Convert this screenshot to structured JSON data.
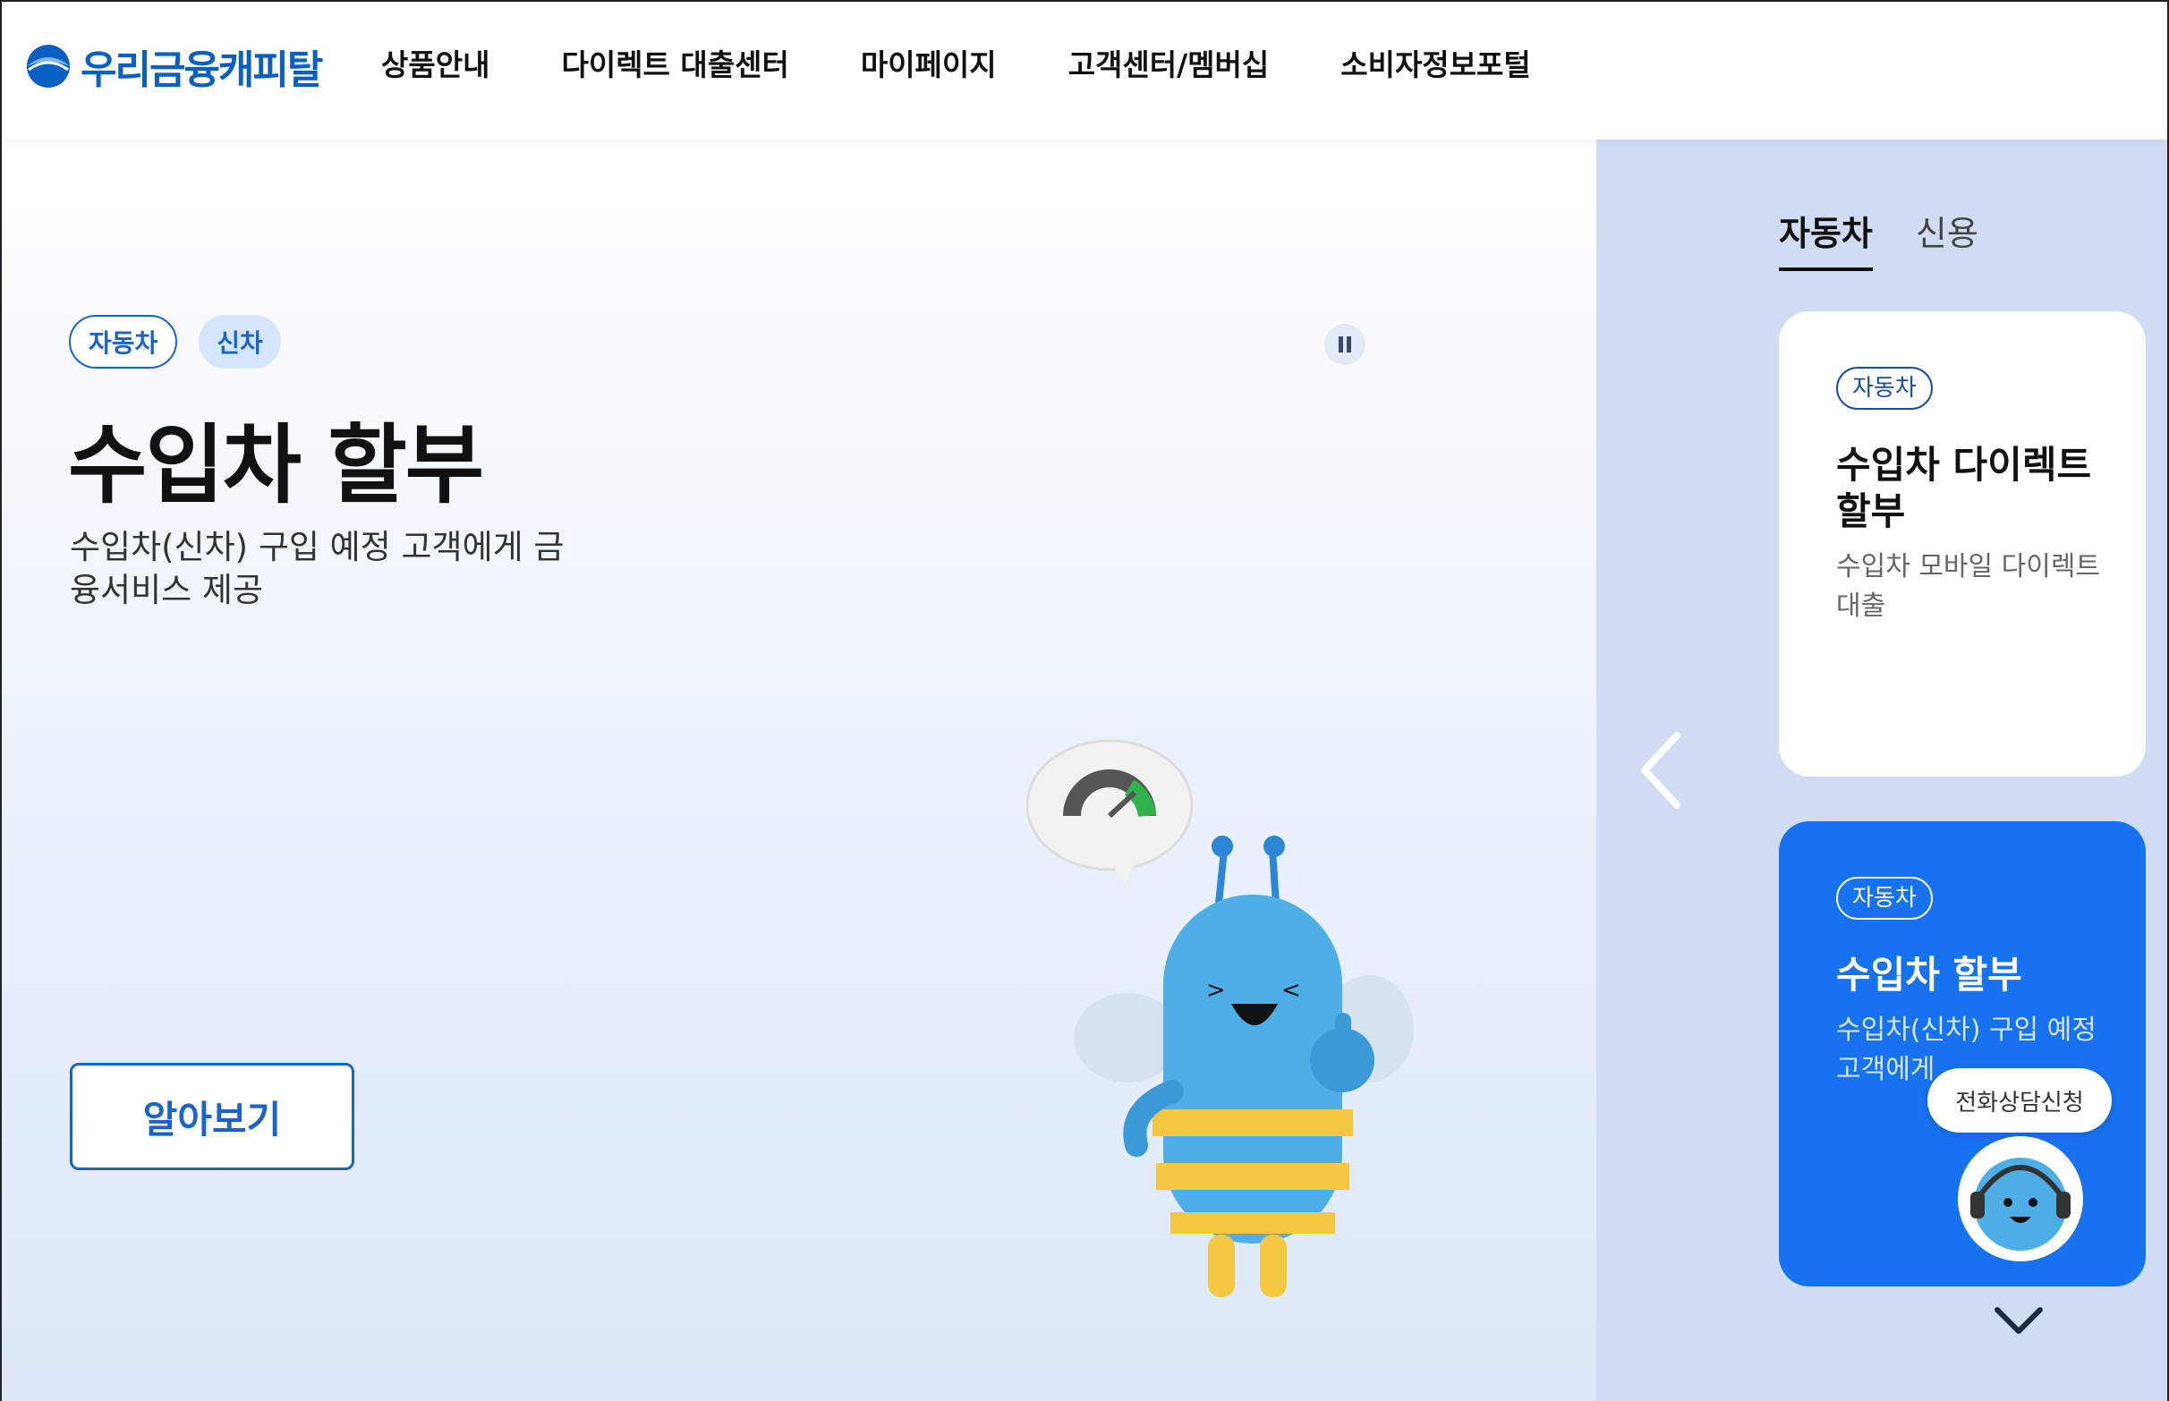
{
  "header": {
    "logo_text": "우리금융캐피탈",
    "nav": [
      "상품안내",
      "다이렉트 대출센터",
      "마이페이지",
      "고객센터/멤버십",
      "소비자정보포털"
    ]
  },
  "hero": {
    "chips": [
      "자동차",
      "신차"
    ],
    "title": "수입차 할부",
    "description": "수입차(신차) 구입 예정 고객에게 금융서비스 제공",
    "cta_label": "알아보기"
  },
  "side": {
    "tabs": [
      "자동차",
      "신용"
    ],
    "active_tab": "자동차",
    "cards": [
      {
        "chip": "자동차",
        "title": "수입차 다이렉트 할부",
        "desc": "수입차 모바일 다이렉트 대출"
      },
      {
        "chip": "자동차",
        "title": "수입차 할부",
        "desc": "수입차(신차) 구입 예정 고객에게"
      }
    ],
    "consult_label": "전화상담신청"
  },
  "colors": {
    "brand": "#0a5fc5",
    "accent_blue": "#1672ee",
    "side_bg": "#cfdcf1"
  }
}
